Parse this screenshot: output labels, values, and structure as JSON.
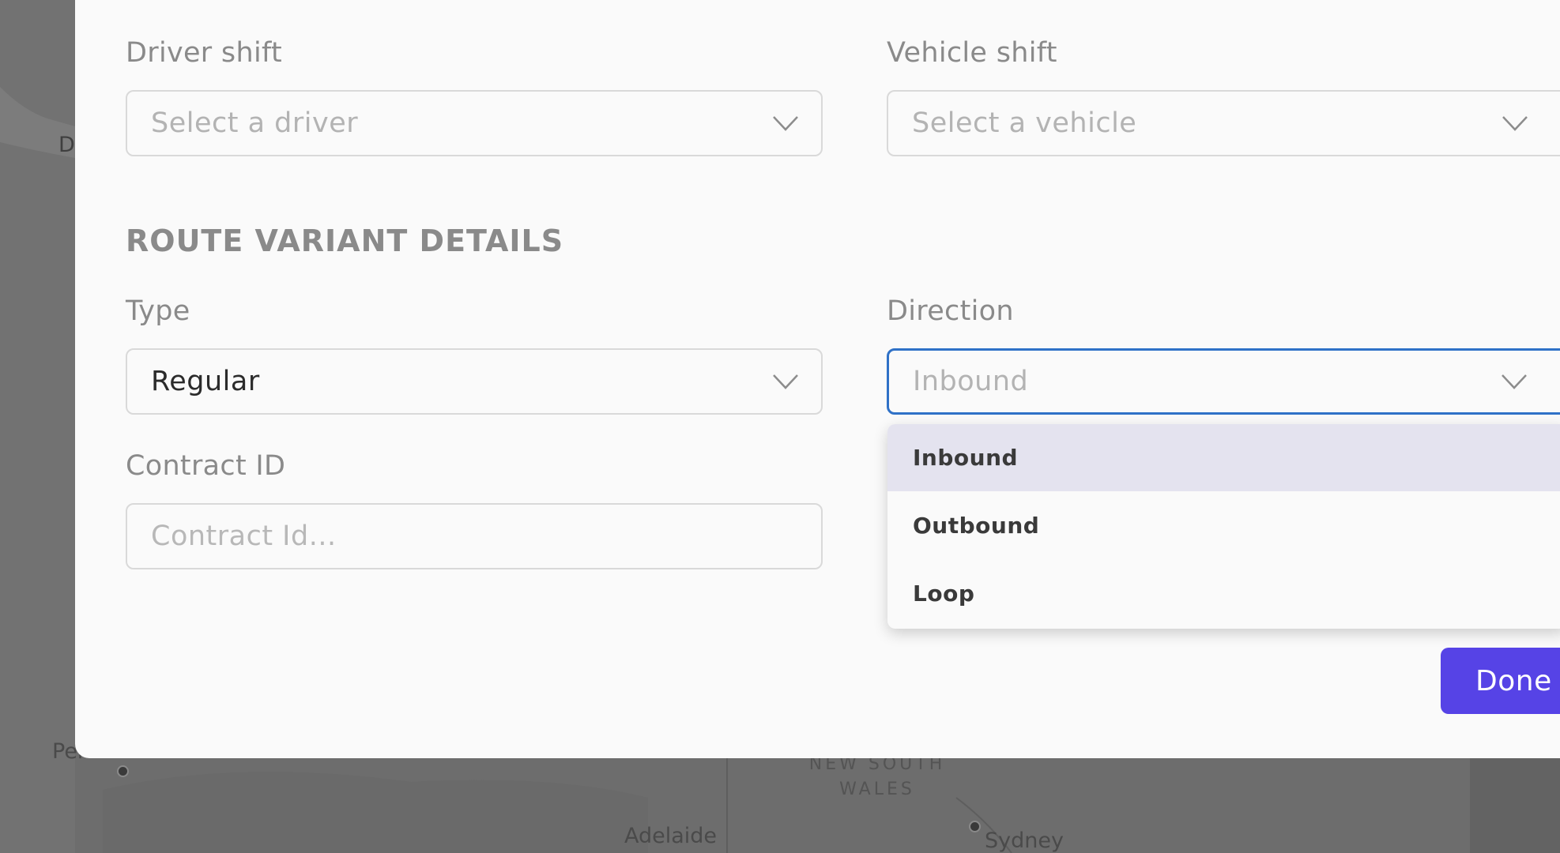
{
  "driver_shift": {
    "label": "Driver shift",
    "placeholder": "Select a driver"
  },
  "vehicle_shift": {
    "label": "Vehicle shift",
    "placeholder": "Select a vehicle"
  },
  "route_variant": {
    "section_title": "ROUTE VARIANT DETAILS",
    "type": {
      "label": "Type",
      "value": "Regular"
    },
    "direction": {
      "label": "Direction",
      "value": "Inbound",
      "options": [
        "Inbound",
        "Outbound",
        "Loop"
      ],
      "highlighted_option": "Inbound"
    },
    "contract_id": {
      "label": "Contract ID",
      "placeholder": "Contract Id..."
    }
  },
  "actions": {
    "done_label": "Done"
  },
  "map": {
    "labels": {
      "perth": "Perth",
      "adelaide": "Adelaide",
      "sydney": "Sydney",
      "nsw_line1": "NEW SOUTH",
      "nsw_line2": "WALES",
      "edge_letter": "D"
    }
  },
  "colors": {
    "accent": "#5643e6",
    "focus_border": "#2f71c7",
    "highlight": "#e4e3ef"
  }
}
